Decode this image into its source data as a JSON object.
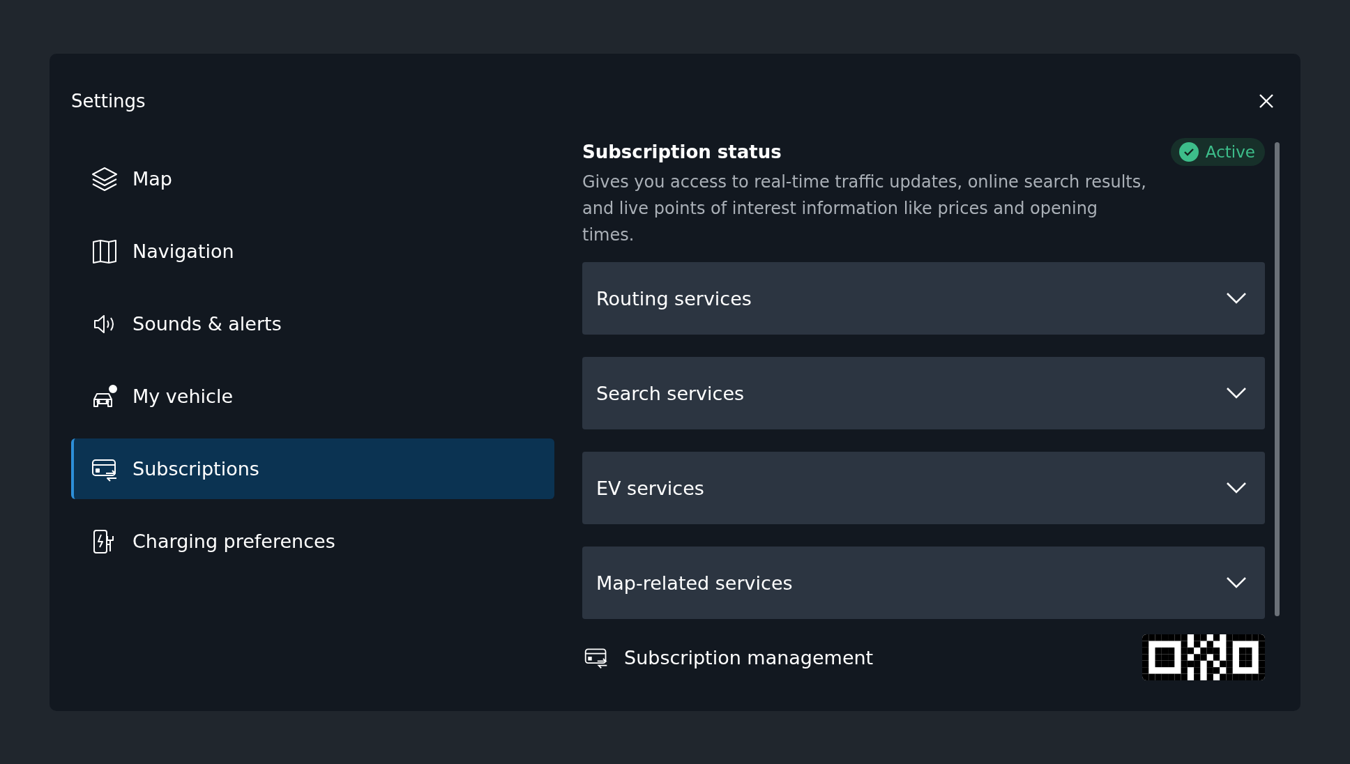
{
  "window": {
    "title": "Settings"
  },
  "sidebar": {
    "items": [
      {
        "label": "Map",
        "selected": false
      },
      {
        "label": "Navigation",
        "selected": false
      },
      {
        "label": "Sounds & alerts",
        "selected": false
      },
      {
        "label": "My vehicle",
        "selected": false
      },
      {
        "label": "Subscriptions",
        "selected": true
      },
      {
        "label": "Charging preferences",
        "selected": false
      }
    ]
  },
  "content": {
    "heading": "Subscription status",
    "status": {
      "label": "Active",
      "active": true
    },
    "description": "Gives you access to real-time traffic updates, online search results, and live points of interest information like prices and opening times.",
    "sections": [
      {
        "title": "Routing services",
        "expanded": false
      },
      {
        "title": "Search services",
        "expanded": false
      },
      {
        "title": "EV services",
        "expanded": false
      },
      {
        "title": "Map-related services",
        "expanded": false
      }
    ],
    "management": {
      "label": "Subscription management"
    }
  }
}
